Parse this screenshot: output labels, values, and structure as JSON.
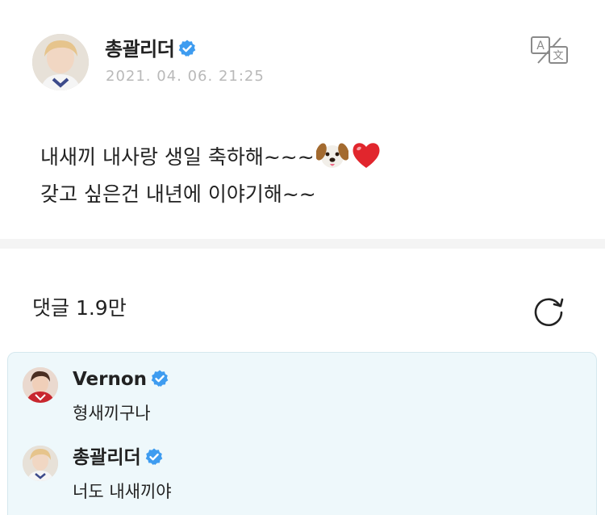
{
  "post": {
    "author": "총괄리더",
    "verified": true,
    "timestamp": "2021. 04. 06. 21:25",
    "line1": "내새끼 내사랑 생일 축하해~~~",
    "line2": "갖고 싶은건 내년에 이야기해~~",
    "emojis": [
      "dog-face-emoji",
      "red-heart-emoji"
    ]
  },
  "toolbar": {
    "translate_icon": "translate-icon"
  },
  "comments": {
    "header": "댓글 1.9만",
    "refresh_icon": "refresh-icon",
    "items": [
      {
        "author": "Vernon",
        "verified": true,
        "text": "형새끼구나"
      },
      {
        "author": "총괄리더",
        "verified": true,
        "text": "너도 내새끼야"
      }
    ]
  },
  "colors": {
    "verified": "#3e9cf0",
    "timestamp": "#b9b9b9",
    "comment_box_bg": "#eef8fb",
    "comment_box_border": "#d5e8ee",
    "divider": "#f4f4f4",
    "text": "#222222"
  }
}
